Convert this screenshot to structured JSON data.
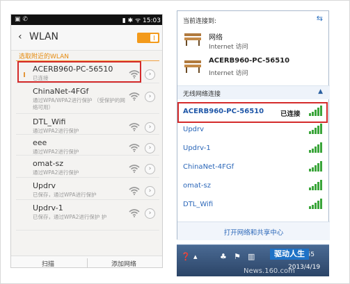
{
  "phone": {
    "status_bar": {
      "left_icons": "▣ ✆",
      "right_text": "▮ ✱ ᯤ 15:03"
    },
    "title": "WLAN",
    "section_label": "选取附近的WLAN",
    "networks": [
      {
        "ssid": "ACERB960-PC-56510",
        "sub": "已连接"
      },
      {
        "ssid": "ChinaNet-4FGf",
        "sub": "通过WPA/WPA2进行保护 （受保护的网络可用）"
      },
      {
        "ssid": "DTL_Wifi",
        "sub": "通过WPA2进行保护"
      },
      {
        "ssid": "eee",
        "sub": "通过WPA2进行保护"
      },
      {
        "ssid": "omat-sz",
        "sub": "通过WPA2进行保护"
      },
      {
        "ssid": "Updrv",
        "sub": "已保存，通过WPA进行保护"
      },
      {
        "ssid": "Updrv-1",
        "sub": "已保存，通过WPA2进行保护 护"
      }
    ],
    "bottom": {
      "scan": "扫描",
      "add": "添加网络"
    }
  },
  "win": {
    "current_label": "当前连接到:",
    "connections": [
      {
        "name": "网络",
        "sub": "Internet 访问"
      },
      {
        "name": "ACERB960-PC-56510",
        "sub": "Internet 访问"
      }
    ],
    "wireless_label": "无线网络连接",
    "connected_ssid": "ACERB960-PC-56510",
    "connected_status": "已连接",
    "networks": [
      "Updrv",
      "Updrv-1",
      "ChinaNet-4FGf",
      "omat-sz",
      "DTL_Wifi"
    ],
    "footer_link": "打开网络和共享中心"
  },
  "taskbar": {
    "time": "15:55",
    "date": "2013/4/19"
  },
  "watermark": {
    "brand": "驱动人生",
    "site": "News.160.com"
  },
  "colors": {
    "accent_orange": "#f39a1b",
    "highlight_red": "#d42a2a",
    "win_link": "#2a66b8",
    "signal_green": "#3aa53a"
  }
}
